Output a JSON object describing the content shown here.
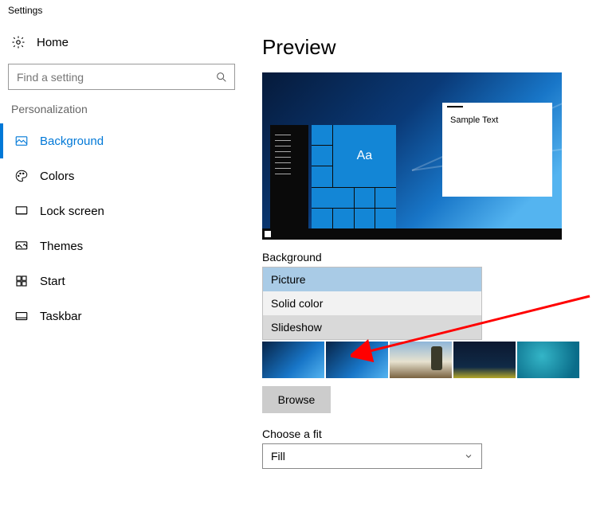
{
  "window_title": "Settings",
  "home_label": "Home",
  "search": {
    "placeholder": "Find a setting"
  },
  "section_label": "Personalization",
  "nav": {
    "items": [
      {
        "label": "Background",
        "name": "nav-background",
        "active": true
      },
      {
        "label": "Colors",
        "name": "nav-colors"
      },
      {
        "label": "Lock screen",
        "name": "nav-lock-screen"
      },
      {
        "label": "Themes",
        "name": "nav-themes"
      },
      {
        "label": "Start",
        "name": "nav-start"
      },
      {
        "label": "Taskbar",
        "name": "nav-taskbar"
      }
    ]
  },
  "main": {
    "preview_heading": "Preview",
    "preview": {
      "sample_text": "Sample Text",
      "tiles_label": "Aa"
    },
    "background_label": "Background",
    "background_dropdown": {
      "options": [
        {
          "label": "Picture",
          "selected": true
        },
        {
          "label": "Solid color"
        },
        {
          "label": "Slideshow",
          "hover": true
        }
      ]
    },
    "browse_label": "Browse",
    "fit_label": "Choose a fit",
    "fit_value": "Fill"
  }
}
